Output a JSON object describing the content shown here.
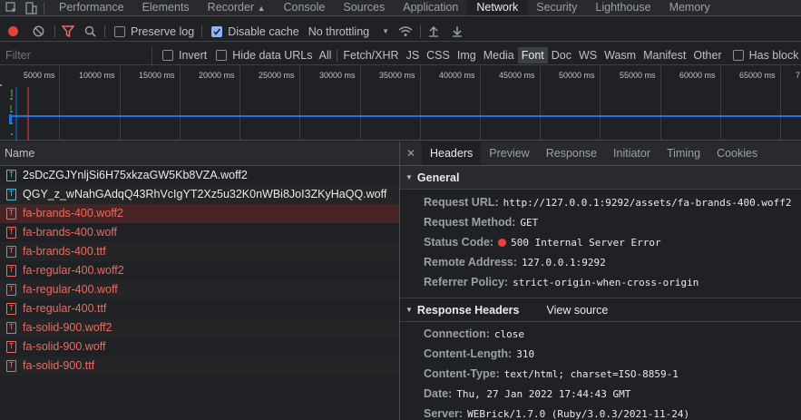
{
  "main_tabs": [
    "Performance",
    "Elements",
    "Recorder",
    "Console",
    "Sources",
    "Application",
    "Network",
    "Security",
    "Lighthouse",
    "Memory"
  ],
  "toolbar": {
    "preserve_log": "Preserve log",
    "disable_cache": "Disable cache",
    "throttling": "No throttling"
  },
  "filter": {
    "placeholder": "Filter",
    "invert": "Invert",
    "hide_data_urls": "Hide data URLs",
    "types": [
      "All",
      "Fetch/XHR",
      "JS",
      "CSS",
      "Img",
      "Media",
      "Font",
      "Doc",
      "WS",
      "Wasm",
      "Manifest",
      "Other"
    ],
    "active_type": "Font",
    "has_blocked": "Has block"
  },
  "timeline_ticks": [
    "5000 ms",
    "10000 ms",
    "15000 ms",
    "20000 ms",
    "25000 ms",
    "30000 ms",
    "35000 ms",
    "40000 ms",
    "45000 ms",
    "50000 ms",
    "55000 ms",
    "60000 ms",
    "65000 ms",
    "7"
  ],
  "requests": {
    "header": "Name",
    "items": [
      {
        "name": "2sDcZGJYnljSi6H75xkzaGW5Kb8VZA.woff2",
        "status": "ok"
      },
      {
        "name": "QGY_z_wNahGAdqQ43RhVcIgYT2Xz5u32K0nWBi8JoI3ZKyHaQQ.woff",
        "status": "ok"
      },
      {
        "name": "fa-brands-400.woff2",
        "status": "error"
      },
      {
        "name": "fa-brands-400.woff",
        "status": "error"
      },
      {
        "name": "fa-brands-400.ttf",
        "status": "error"
      },
      {
        "name": "fa-regular-400.woff2",
        "status": "error"
      },
      {
        "name": "fa-regular-400.woff",
        "status": "error"
      },
      {
        "name": "fa-regular-400.ttf",
        "status": "error"
      },
      {
        "name": "fa-solid-900.woff2",
        "status": "error"
      },
      {
        "name": "fa-solid-900.woff",
        "status": "error"
      },
      {
        "name": "fa-solid-900.ttf",
        "status": "error"
      }
    ]
  },
  "detail_tabs": [
    "Headers",
    "Preview",
    "Response",
    "Initiator",
    "Timing",
    "Cookies"
  ],
  "general": {
    "title": "General",
    "request_url_key": "Request URL:",
    "request_url": "http://127.0.0.1:9292/assets/fa-brands-400.woff2",
    "request_method_key": "Request Method:",
    "request_method": "GET",
    "status_code_key": "Status Code:",
    "status_code": "500 Internal Server Error",
    "remote_address_key": "Remote Address:",
    "remote_address": "127.0.0.1:9292",
    "referrer_policy_key": "Referrer Policy:",
    "referrer_policy": "strict-origin-when-cross-origin"
  },
  "response_headers": {
    "title": "Response Headers",
    "view_source": "View source",
    "connection_key": "Connection:",
    "connection": "close",
    "content_length_key": "Content-Length:",
    "content_length": "310",
    "content_type_key": "Content-Type:",
    "content_type": "text/html; charset=ISO-8859-1",
    "date_key": "Date:",
    "date": "Thu, 27 Jan 2022 17:44:43 GMT",
    "server_key": "Server:",
    "server": "WEBrick/1.7.0 (Ruby/3.0.3/2021-11-24)"
  }
}
